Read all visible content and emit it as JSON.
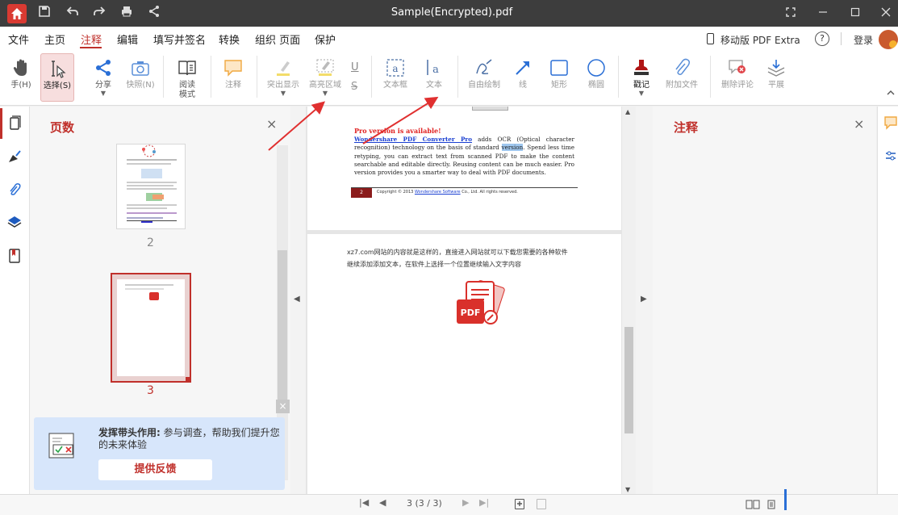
{
  "title_bar": {
    "title": "Sample(Encrypted).pdf",
    "icons": [
      "home-icon",
      "save-icon",
      "undo-icon",
      "redo-icon",
      "print-icon",
      "share-icon",
      "fullscreen-icon",
      "minimize-icon",
      "maximize-icon",
      "close-icon"
    ]
  },
  "menu": {
    "items": [
      "文件",
      "主页",
      "注释",
      "编辑",
      "填写并签名",
      "转换",
      "组织 页面",
      "保护"
    ],
    "active": "注释",
    "mobile_label": "移动版 PDF Extra",
    "help": "?",
    "login": "登录"
  },
  "toolbar": {
    "hand": "手(H)",
    "select": "选择(S)",
    "share": "分享",
    "snapshot": "快照(N)",
    "read_mode": "阅读\n模式",
    "comment": "注释",
    "highlight": "突出显示",
    "highlight_area": "高亮区域",
    "textbox": "文本框",
    "text": "文本",
    "freehand": "自由绘制",
    "line": "线",
    "rectangle": "矩形",
    "ellipse": "椭圆",
    "stamp": "戳记",
    "attach_file": "附加文件",
    "delete_comments": "删除评论",
    "flatten": "平展",
    "underline_glyph": "U",
    "strike_glyph": "S",
    "textbox_glyph": "a",
    "text_glyph": "Ia"
  },
  "pages_panel": {
    "title": "页数",
    "close": "×",
    "pages": [
      {
        "number": "2",
        "selected": false
      },
      {
        "number": "3",
        "selected": true
      }
    ],
    "collapse": "×"
  },
  "feedback": {
    "title": "发挥带头作用:",
    "text": "参与调查，帮助我们提升您的未来体验",
    "button": "提供反馈"
  },
  "document": {
    "page1": {
      "heading": "Pro version is available!",
      "link": "Wondershare PDF Converter Pro",
      "body_a": " adds OCR (Optical character recognition) technology on the basis of standard ",
      "highlight": "version",
      "body_b": ". Spend less time retyping, you can extract text from scanned PDF to make the content searchable and editable directly. Reusing content can be much easier. Pro version provides you a smarter way to deal with PDF documents.",
      "footer_page": "2",
      "footer_copy_a": "Copyright © 2013 ",
      "footer_copy_link": "Wondershare Software",
      "footer_copy_b": " Co., Ltd. All rights reserved."
    },
    "page2": {
      "line1": "xz7.com网站的内容就是这样的，直接进入网站就可以下载您需要的各种软件",
      "line2": "继续添加添加文本，在软件上选择一个位置继续输入文字内容",
      "logo_text": "PDF"
    },
    "colors": {
      "accent": "#c0302b",
      "link": "#1a3fd1",
      "annotation_arrow": "#e03030"
    }
  },
  "annotations_panel": {
    "title": "注释",
    "close": "×"
  },
  "status": {
    "page_counter": "3 (3 / 3)",
    "first": "|◀",
    "prev": "◀",
    "next": "▶",
    "last": "▶|"
  }
}
